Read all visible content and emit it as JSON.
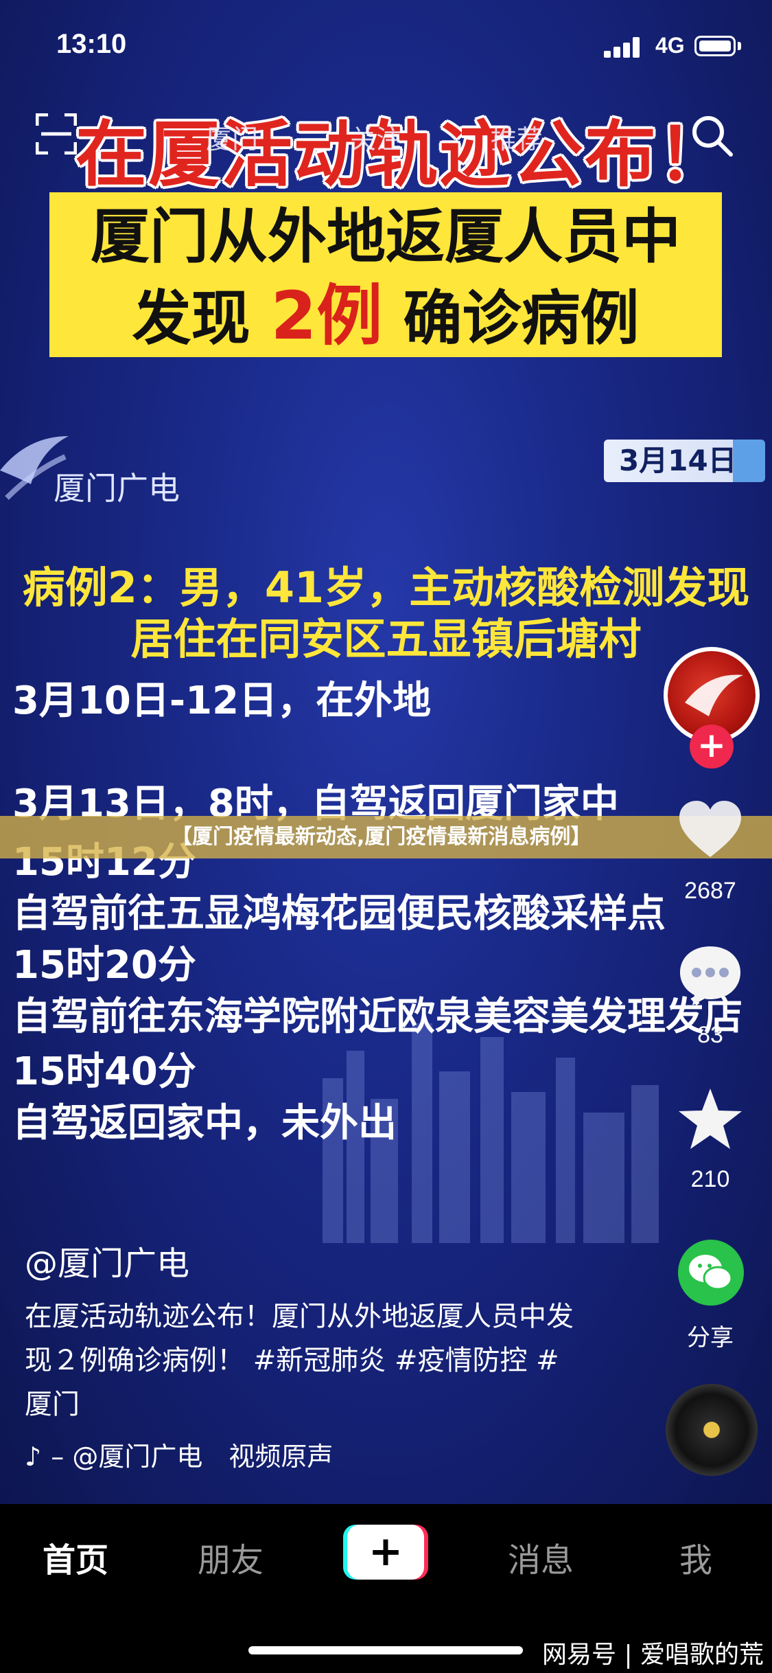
{
  "status_bar": {
    "time": "13:10",
    "network": "4G"
  },
  "top_nav": {
    "tabs": [
      "厦门",
      "关注",
      "推荐"
    ]
  },
  "video": {
    "headline": "在厦活动轨迹公布！",
    "box_line1": "厦门从外地返厦人员中",
    "box_line2_pre": "发现",
    "box_line2_num": "2例",
    "box_line2_post": "确诊病例",
    "station_name": "厦门广电",
    "date_badge": "3月14日",
    "case_line1": "病例2：男，41岁，主动核酸检测发现",
    "case_line2": "居住在同安区五显镇后塘村",
    "details": [
      "3月10日-12日，在外地",
      "3月13日，8时，自驾返回厦门家中",
      "15时12分",
      "自驾前往五显鸿梅花园便民核酸采样点",
      "15时20分",
      "自驾前往东海学院附近欧泉美容美发理发店",
      "15时40分",
      "自驾返回家中，未外出"
    ]
  },
  "caption_band": "【厦门疫情最新动态,厦门疫情最新消息病例】",
  "actions": {
    "likes": "2687",
    "comments": "83",
    "favorites": "210",
    "share_label": "分享"
  },
  "post": {
    "author": "@厦门广电",
    "description": "在厦活动轨迹公布！厦门从外地返厦人员中发现２例确诊病例！ #新冠肺炎 #疫情防控 #厦门",
    "music": "– @厦门广电　视频原声"
  },
  "tabbar": {
    "tabs": [
      "首页",
      "朋友",
      "消息",
      "我"
    ],
    "plus": "+"
  },
  "watermark": "网易号 | 爱唱歌的荒",
  "colors": {
    "accent_red": "#e0251f",
    "accent_yellow": "#ffe63a",
    "like_pink": "#fe2c55",
    "share_green": "#29c24a"
  }
}
